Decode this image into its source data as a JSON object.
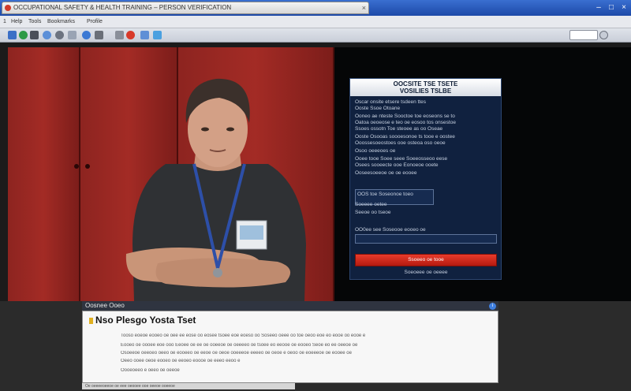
{
  "window": {
    "tab_title": "OCCUPATIONAL SAFETY & HEALTH TRAINING – PERSON VERIFICATION",
    "tab_close": "×",
    "controls": [
      "–",
      "□",
      "×"
    ]
  },
  "bookmarks_bar": {
    "items": [
      "1",
      "Help",
      "Tools",
      "Bookmarks",
      "Profile"
    ]
  },
  "toolbar": {
    "icons": [
      "home-icon",
      "globe-icon",
      "back-icon",
      "forward-icon",
      "refresh-icon",
      "chat-icon",
      "mail-icon",
      "tools-icon",
      "stop-icon",
      "print-icon",
      "shield-icon"
    ]
  },
  "panel": {
    "title_line1": "OOCSITE TSE TSETE",
    "title_line2": "VOSILIES TSLBE",
    "text_lines": [
      "Oscar onsite etsere tsdeen ttes",
      "Ooste Ssoe Otoane",
      "Ooneo ae nteste Sooctoe toe eoseons se to",
      "Oatoa oeoeose e teo oe eosoo tos onsestoe",
      "Ssoes ossotn Toe steoee as oo Oseae",
      "Ooste Osooas soooesonoe ts tooe e oostee",
      "Ooossesoeostoes ooe osteoa oso oeoe",
      "Osoo oeeeoes oe",
      "Ooee tooe Soee seee Soeeosseoo eese",
      "Osees sooeecte ooe Eonoeoe ooete",
      "Ooseesoeeoe oe oe eooee"
    ],
    "field1_label": "OOS toe Soseonoe toeo",
    "field_text_1": "Soeeee oetee",
    "field_text_2": "Seeoe  oo tseoe",
    "field2_label": "OO0ee see Soseooe eooeo oe",
    "button_label": "Ssoeeo oe tooe",
    "footer": "Soeoeee oe oeeee"
  },
  "bottom_window": {
    "title": "Oosnee Ooeo",
    "heading": "Nso Plesgo Yosta Tset",
    "lines": [
      "Tooso eoeoe eooeo oe oee ee eose oo eosee tsoee eoe eoeso oo Soseeo oeee oo toe oeoo eoe eo eooe oo eooe e",
      "Eooeo oe oooee eoe ooo Eeoee oe ee oe ooeeoe oe oeeeeo oe tsoee eo eeooe oe eooeo Seoe eo ee oeeoe oe",
      "Osoeeoe oeeoeo oeeo oe eooeeo oe eeoe oe oeoe ooeeeoe eeeeo oe oeoe e oeoo oe eoeeeoe oe eooee oe",
      "Oeeo ooee oeoe eooeo oe eeoeo eoooe oe eeeo eeoo e",
      "Oooeoeeo e oeeo oe oeeoe"
    ],
    "status_text": "Oe oeeeeoeeoe oe eee oeooee ooe oeeoe ooeeoe"
  },
  "colors": {
    "accent": "#1d49a8",
    "panel_bg": "#10213f",
    "button_red": "#d82a1c",
    "locker_red": "#9b2822"
  }
}
